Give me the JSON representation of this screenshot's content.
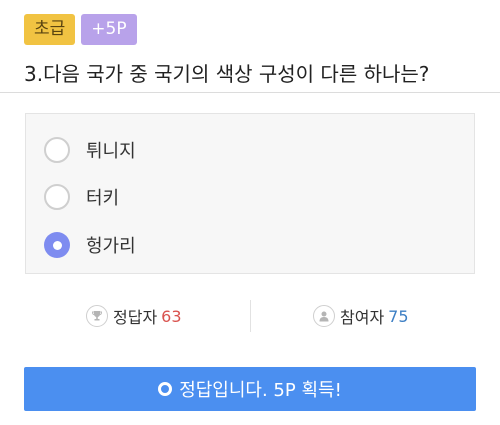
{
  "badges": {
    "level": "초급",
    "points": "+5P"
  },
  "question": {
    "text": "3.다음 국가 중 국기의 색상 구성이 다른 하나는?"
  },
  "options": [
    {
      "label": "튀니지",
      "selected": false
    },
    {
      "label": "터키",
      "selected": false
    },
    {
      "label": "헝가리",
      "selected": true
    }
  ],
  "stats": {
    "correct_label": "정답자",
    "correct_count": "63",
    "participants_label": "참여자",
    "participants_count": "75"
  },
  "result": {
    "message": "정답입니다. 5P 획득!"
  },
  "colors": {
    "level_badge": "#f1c342",
    "points_badge": "#b8a2ea",
    "selected_radio": "#7e8cf0",
    "result_button": "#4b8ff0",
    "correct_count": "#d9534f",
    "participants_count": "#3d7fc4"
  },
  "icons": {
    "correct": "trophy-icon",
    "participants": "user-icon",
    "result": "check-circle-icon"
  }
}
